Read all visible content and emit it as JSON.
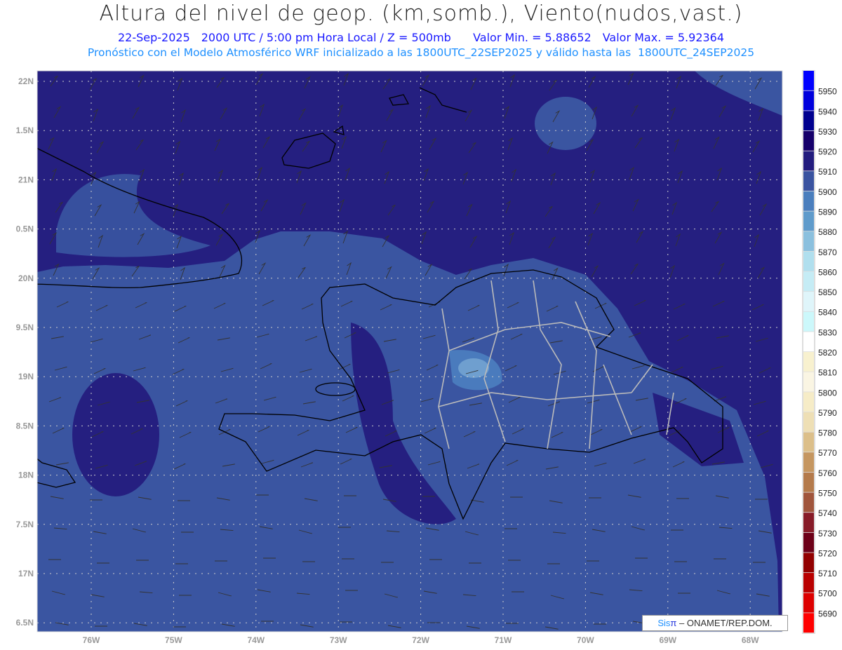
{
  "header": {
    "title": "Altura del nivel de geop. (km,somb.), Viento(nudos,vast.)",
    "date": "22-Sep-2025",
    "time": "2000 UTC / 5:00 pm Hora Local / Z = 500mb",
    "min_label": "Valor Min. = 5.88652",
    "max_label": "Valor Max. = 5.92364",
    "model_line": "Pronóstico con el Modelo Atmosférico WRF inicializado a las 1800UTC_22SEP2025 y válido hasta las  1800UTC_24SEP2025"
  },
  "map": {
    "lat_labels": [
      "22N",
      "1.5N",
      "21N",
      "0.5N",
      "20N",
      "9.5N",
      "19N",
      "8.5N",
      "18N",
      "7.5N",
      "17N",
      "6.5N"
    ],
    "lon_labels": [
      "76W",
      "75W",
      "74W",
      "73W",
      "72W",
      "71W",
      "70W",
      "69W",
      "68W"
    ],
    "colors": {
      "dark": "#251f80",
      "medium": "#3a55a1",
      "light": "#4a7bbd",
      "lighter": "#6f9fcf"
    }
  },
  "colorbar": {
    "labels": [
      "5950",
      "5940",
      "5930",
      "5920",
      "5910",
      "5900",
      "5890",
      "5880",
      "5870",
      "5860",
      "5850",
      "5840",
      "5830",
      "5820",
      "5810",
      "5800",
      "5790",
      "5780",
      "5770",
      "5760",
      "5750",
      "5740",
      "5730",
      "5720",
      "5710",
      "5700",
      "5690"
    ],
    "colors": [
      "#0000ff",
      "#0000dd",
      "#00008f",
      "#16006b",
      "#231c7e",
      "#3a53a0",
      "#4a7ebd",
      "#5f9bcb",
      "#8bc0de",
      "#b0dfee",
      "#c5ecf5",
      "#dff5fa",
      "#ccf8fb",
      "#ffffff",
      "#f8f1cf",
      "#faf5e3",
      "#f6ecc7",
      "#eedfb5",
      "#dcbf8a",
      "#c59660",
      "#b47a4b",
      "#a0553c",
      "#871b28",
      "#6d0018",
      "#920000",
      "#b90000",
      "#dd0000",
      "#ff0000"
    ]
  },
  "logo": {
    "sis": "Sis",
    "pi": "π",
    "text": "– ONAMET/REP.DOM."
  }
}
